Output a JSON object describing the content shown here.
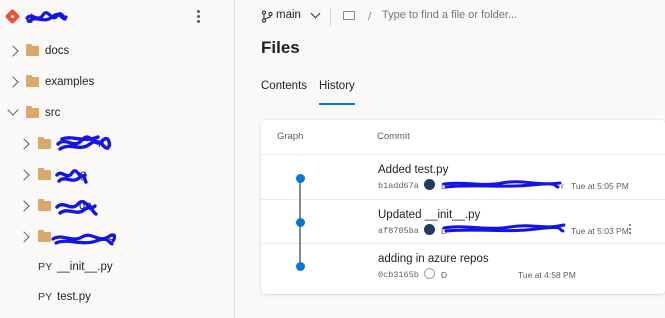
{
  "sidebar": {
    "repo_name": "d",
    "items": [
      {
        "type": "folder",
        "label": "docs",
        "state": "collapsed"
      },
      {
        "type": "folder",
        "label": "examples",
        "state": "collapsed"
      },
      {
        "type": "folder",
        "label": "src",
        "state": "expanded"
      },
      {
        "type": "folder",
        "label": "n",
        "state": "collapsed",
        "redacted": true
      },
      {
        "type": "folder",
        "label": "g",
        "state": "collapsed",
        "redacted": true
      },
      {
        "type": "folder",
        "label": "de",
        "state": "collapsed",
        "redacted": true
      },
      {
        "type": "folder",
        "label": "e",
        "state": "collapsed",
        "redacted": true
      },
      {
        "type": "file",
        "tag": "PY",
        "label": "__init__.py"
      },
      {
        "type": "file",
        "tag": "PY",
        "label": "test.py"
      }
    ]
  },
  "topbar": {
    "branch": "main",
    "path_sep": "/",
    "search_placeholder": "Type to find a file or folder..."
  },
  "page": {
    "title": "Files",
    "tabs": [
      {
        "label": "Contents",
        "active": false
      },
      {
        "label": "History",
        "active": true
      }
    ]
  },
  "history": {
    "col_graph": "Graph",
    "col_commit": "Commit",
    "commits": [
      {
        "message": "Added test.py",
        "id": "b1add67a",
        "author": "D",
        "author_suffix": "r",
        "time": "Tue at 5:05 PM"
      },
      {
        "message": "Updated __init__.py",
        "id": "af8705ba",
        "author": "D",
        "author_suffix": "",
        "time": "Tue at 5:03 PM"
      },
      {
        "message": "adding in azure repos",
        "id": "0cb3165b",
        "author": "D",
        "author_suffix": "",
        "time": "Tue at 4:58 PM"
      }
    ]
  },
  "colors": {
    "accent": "#0078d4",
    "redaction": "#1414e6",
    "folder": "#d8a96b",
    "git": "#f05133"
  }
}
